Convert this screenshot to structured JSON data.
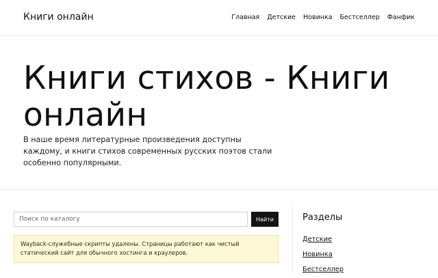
{
  "header": {
    "brand": "Книги онлайн",
    "nav": [
      "Главная",
      "Детские",
      "Новинка",
      "Бестселлер",
      "Фанфик"
    ]
  },
  "hero": {
    "title": "Книги стихов - Книги онлайн",
    "lead": "В наше время литературные произведения доступны каждому, и книги стихов современных русских поэтов стали особенно популярными."
  },
  "search": {
    "placeholder": "Поиск по каталогу",
    "button": "Найти"
  },
  "notice": {
    "text": "Wayback-служебные скрипты удалены. Страницы работают как чистый статический сайт для обычного хостинга и краулеров."
  },
  "sidebar": {
    "title": "Разделы",
    "items": [
      "Детские",
      "Новинка",
      "Бестселлер"
    ]
  }
}
